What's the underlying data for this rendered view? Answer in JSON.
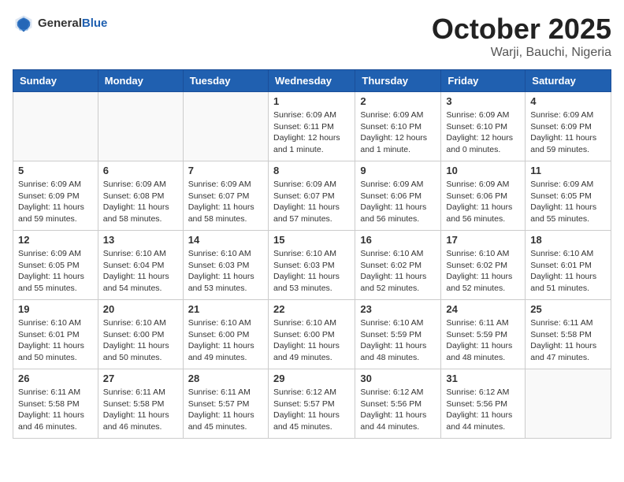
{
  "header": {
    "logo_general": "General",
    "logo_blue": "Blue",
    "title": "October 2025",
    "location": "Warji, Bauchi, Nigeria"
  },
  "weekdays": [
    "Sunday",
    "Monday",
    "Tuesday",
    "Wednesday",
    "Thursday",
    "Friday",
    "Saturday"
  ],
  "weeks": [
    [
      {
        "day": "",
        "info": ""
      },
      {
        "day": "",
        "info": ""
      },
      {
        "day": "",
        "info": ""
      },
      {
        "day": "1",
        "info": "Sunrise: 6:09 AM\nSunset: 6:11 PM\nDaylight: 12 hours\nand 1 minute."
      },
      {
        "day": "2",
        "info": "Sunrise: 6:09 AM\nSunset: 6:10 PM\nDaylight: 12 hours\nand 1 minute."
      },
      {
        "day": "3",
        "info": "Sunrise: 6:09 AM\nSunset: 6:10 PM\nDaylight: 12 hours\nand 0 minutes."
      },
      {
        "day": "4",
        "info": "Sunrise: 6:09 AM\nSunset: 6:09 PM\nDaylight: 11 hours\nand 59 minutes."
      }
    ],
    [
      {
        "day": "5",
        "info": "Sunrise: 6:09 AM\nSunset: 6:09 PM\nDaylight: 11 hours\nand 59 minutes."
      },
      {
        "day": "6",
        "info": "Sunrise: 6:09 AM\nSunset: 6:08 PM\nDaylight: 11 hours\nand 58 minutes."
      },
      {
        "day": "7",
        "info": "Sunrise: 6:09 AM\nSunset: 6:07 PM\nDaylight: 11 hours\nand 58 minutes."
      },
      {
        "day": "8",
        "info": "Sunrise: 6:09 AM\nSunset: 6:07 PM\nDaylight: 11 hours\nand 57 minutes."
      },
      {
        "day": "9",
        "info": "Sunrise: 6:09 AM\nSunset: 6:06 PM\nDaylight: 11 hours\nand 56 minutes."
      },
      {
        "day": "10",
        "info": "Sunrise: 6:09 AM\nSunset: 6:06 PM\nDaylight: 11 hours\nand 56 minutes."
      },
      {
        "day": "11",
        "info": "Sunrise: 6:09 AM\nSunset: 6:05 PM\nDaylight: 11 hours\nand 55 minutes."
      }
    ],
    [
      {
        "day": "12",
        "info": "Sunrise: 6:09 AM\nSunset: 6:05 PM\nDaylight: 11 hours\nand 55 minutes."
      },
      {
        "day": "13",
        "info": "Sunrise: 6:10 AM\nSunset: 6:04 PM\nDaylight: 11 hours\nand 54 minutes."
      },
      {
        "day": "14",
        "info": "Sunrise: 6:10 AM\nSunset: 6:03 PM\nDaylight: 11 hours\nand 53 minutes."
      },
      {
        "day": "15",
        "info": "Sunrise: 6:10 AM\nSunset: 6:03 PM\nDaylight: 11 hours\nand 53 minutes."
      },
      {
        "day": "16",
        "info": "Sunrise: 6:10 AM\nSunset: 6:02 PM\nDaylight: 11 hours\nand 52 minutes."
      },
      {
        "day": "17",
        "info": "Sunrise: 6:10 AM\nSunset: 6:02 PM\nDaylight: 11 hours\nand 52 minutes."
      },
      {
        "day": "18",
        "info": "Sunrise: 6:10 AM\nSunset: 6:01 PM\nDaylight: 11 hours\nand 51 minutes."
      }
    ],
    [
      {
        "day": "19",
        "info": "Sunrise: 6:10 AM\nSunset: 6:01 PM\nDaylight: 11 hours\nand 50 minutes."
      },
      {
        "day": "20",
        "info": "Sunrise: 6:10 AM\nSunset: 6:00 PM\nDaylight: 11 hours\nand 50 minutes."
      },
      {
        "day": "21",
        "info": "Sunrise: 6:10 AM\nSunset: 6:00 PM\nDaylight: 11 hours\nand 49 minutes."
      },
      {
        "day": "22",
        "info": "Sunrise: 6:10 AM\nSunset: 6:00 PM\nDaylight: 11 hours\nand 49 minutes."
      },
      {
        "day": "23",
        "info": "Sunrise: 6:10 AM\nSunset: 5:59 PM\nDaylight: 11 hours\nand 48 minutes."
      },
      {
        "day": "24",
        "info": "Sunrise: 6:11 AM\nSunset: 5:59 PM\nDaylight: 11 hours\nand 48 minutes."
      },
      {
        "day": "25",
        "info": "Sunrise: 6:11 AM\nSunset: 5:58 PM\nDaylight: 11 hours\nand 47 minutes."
      }
    ],
    [
      {
        "day": "26",
        "info": "Sunrise: 6:11 AM\nSunset: 5:58 PM\nDaylight: 11 hours\nand 46 minutes."
      },
      {
        "day": "27",
        "info": "Sunrise: 6:11 AM\nSunset: 5:58 PM\nDaylight: 11 hours\nand 46 minutes."
      },
      {
        "day": "28",
        "info": "Sunrise: 6:11 AM\nSunset: 5:57 PM\nDaylight: 11 hours\nand 45 minutes."
      },
      {
        "day": "29",
        "info": "Sunrise: 6:12 AM\nSunset: 5:57 PM\nDaylight: 11 hours\nand 45 minutes."
      },
      {
        "day": "30",
        "info": "Sunrise: 6:12 AM\nSunset: 5:56 PM\nDaylight: 11 hours\nand 44 minutes."
      },
      {
        "day": "31",
        "info": "Sunrise: 6:12 AM\nSunset: 5:56 PM\nDaylight: 11 hours\nand 44 minutes."
      },
      {
        "day": "",
        "info": ""
      }
    ]
  ]
}
